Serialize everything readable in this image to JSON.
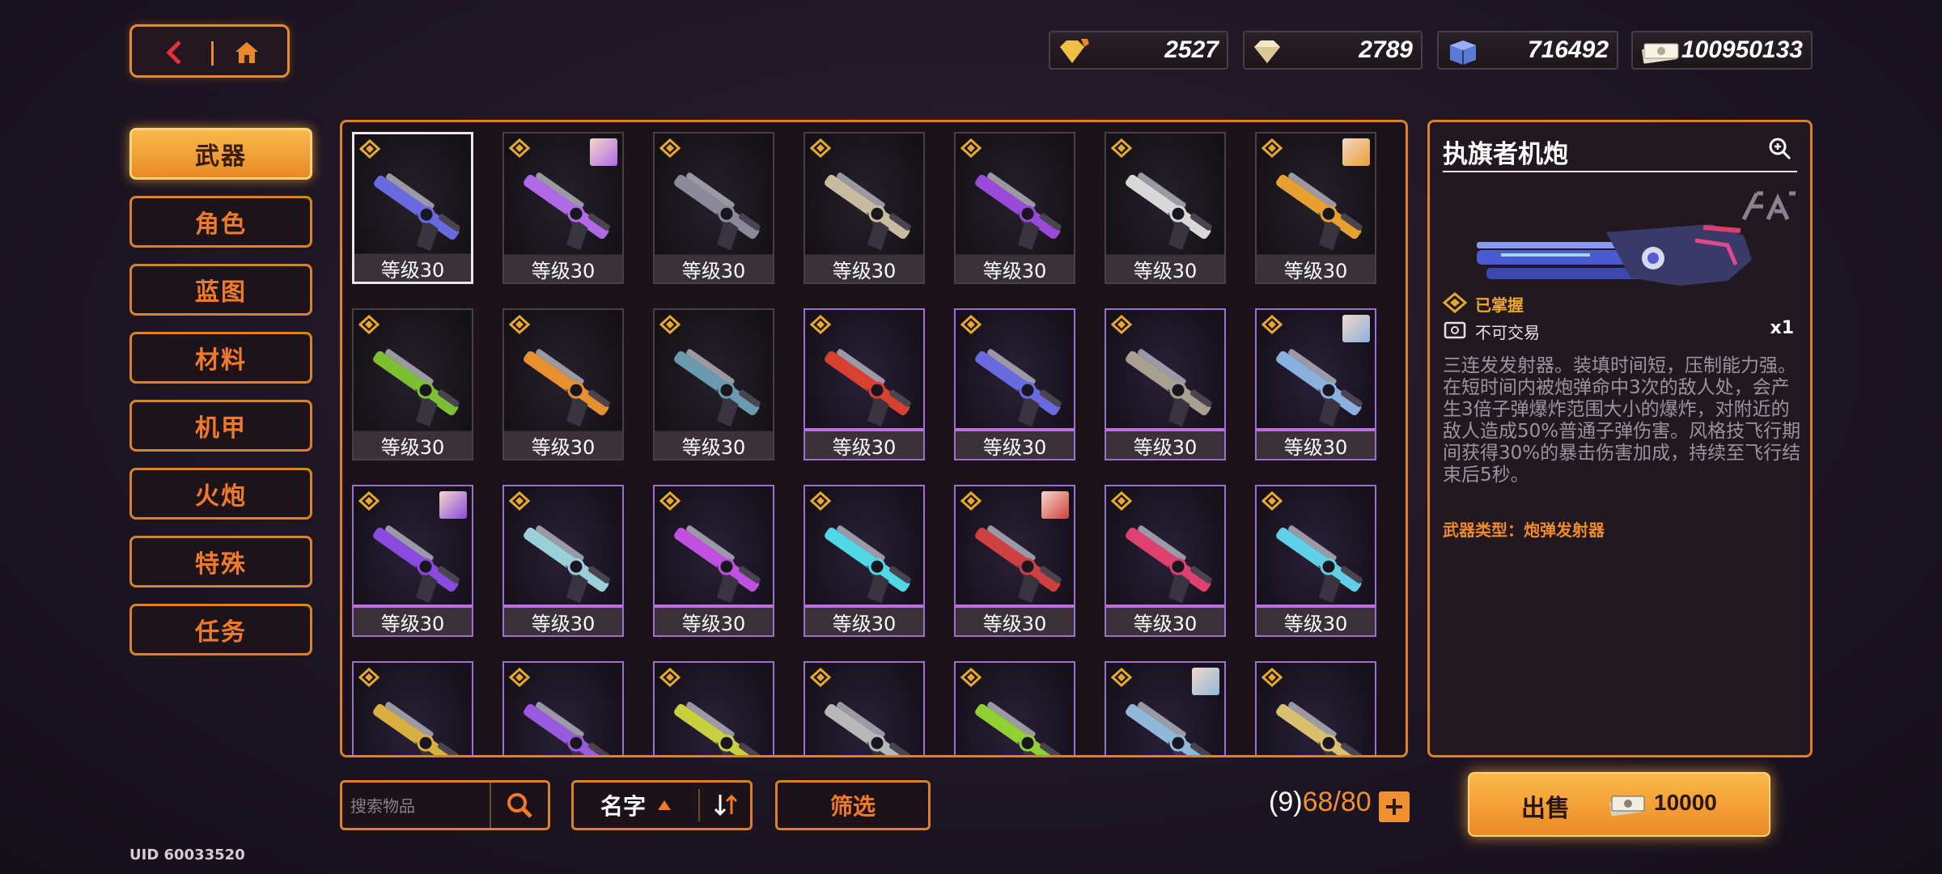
{
  "nav": {
    "back_icon": "chevron-left-icon",
    "home_icon": "home-icon"
  },
  "currencies": [
    {
      "icon": "gold-diamond-gem-icon",
      "value": "2527"
    },
    {
      "icon": "diamond-gem-icon",
      "value": "2789"
    },
    {
      "icon": "blue-crate-icon",
      "value": "716492"
    },
    {
      "icon": "cash-stack-icon",
      "value": "100950133"
    }
  ],
  "sidebar": {
    "items": [
      {
        "label": "武器",
        "active": true
      },
      {
        "label": "角色",
        "active": false
      },
      {
        "label": "蓝图",
        "active": false
      },
      {
        "label": "材料",
        "active": false
      },
      {
        "label": "机甲",
        "active": false
      },
      {
        "label": "火炮",
        "active": false
      },
      {
        "label": "特殊",
        "active": false
      },
      {
        "label": "任务",
        "active": false
      }
    ]
  },
  "grid": {
    "items": [
      {
        "level": "等级30",
        "rarity": "grey",
        "selected": true,
        "color": "#6a6ae0",
        "avatar": false
      },
      {
        "level": "等级30",
        "rarity": "grey",
        "selected": false,
        "color": "#b06ae8",
        "avatar": true
      },
      {
        "level": "等级30",
        "rarity": "grey",
        "selected": false,
        "color": "#8a8a9a",
        "avatar": false
      },
      {
        "level": "等级30",
        "rarity": "grey",
        "selected": false,
        "color": "#c8bca0",
        "avatar": false
      },
      {
        "level": "等级30",
        "rarity": "grey",
        "selected": false,
        "color": "#9a4ad8",
        "avatar": false
      },
      {
        "level": "等级30",
        "rarity": "grey",
        "selected": false,
        "color": "#d8d8d8",
        "avatar": false
      },
      {
        "level": "等级30",
        "rarity": "grey",
        "selected": false,
        "color": "#e8a030",
        "avatar": true
      },
      {
        "level": "等级30",
        "rarity": "grey",
        "selected": false,
        "color": "#7ac030",
        "avatar": false
      },
      {
        "level": "等级30",
        "rarity": "grey",
        "selected": false,
        "color": "#e89030",
        "avatar": false
      },
      {
        "level": "等级30",
        "rarity": "grey",
        "selected": false,
        "color": "#6a9ab0",
        "avatar": false
      },
      {
        "level": "等级30",
        "rarity": "purple",
        "selected": false,
        "color": "#d84030",
        "avatar": false
      },
      {
        "level": "等级30",
        "rarity": "purple",
        "selected": false,
        "color": "#6a6ae0",
        "avatar": false
      },
      {
        "level": "等级30",
        "rarity": "purple",
        "selected": false,
        "color": "#a8a090",
        "avatar": false
      },
      {
        "level": "等级30",
        "rarity": "purple",
        "selected": false,
        "color": "#8ab0e0",
        "avatar": true
      },
      {
        "level": "等级30",
        "rarity": "purple",
        "selected": false,
        "color": "#8a4ae0",
        "avatar": true
      },
      {
        "level": "等级30",
        "rarity": "purple",
        "selected": false,
        "color": "#9ad0d8",
        "avatar": false
      },
      {
        "level": "等级30",
        "rarity": "purple",
        "selected": false,
        "color": "#c050e0",
        "avatar": false
      },
      {
        "level": "等级30",
        "rarity": "purple",
        "selected": false,
        "color": "#50d8e8",
        "avatar": false
      },
      {
        "level": "等级30",
        "rarity": "purple",
        "selected": false,
        "color": "#d04040",
        "avatar": true
      },
      {
        "level": "等级30",
        "rarity": "purple",
        "selected": false,
        "color": "#e04070",
        "avatar": false
      },
      {
        "level": "等级30",
        "rarity": "purple",
        "selected": false,
        "color": "#60d0e8",
        "avatar": false
      },
      {
        "level": "",
        "rarity": "purple",
        "selected": false,
        "color": "#d8b040",
        "avatar": false
      },
      {
        "level": "",
        "rarity": "purple",
        "selected": false,
        "color": "#9a5ae0",
        "avatar": false
      },
      {
        "level": "",
        "rarity": "purple",
        "selected": false,
        "color": "#c8d040",
        "avatar": false
      },
      {
        "level": "",
        "rarity": "purple",
        "selected": false,
        "color": "#b8b8b8",
        "avatar": false
      },
      {
        "level": "",
        "rarity": "purple",
        "selected": false,
        "color": "#90d030",
        "avatar": false
      },
      {
        "level": "",
        "rarity": "purple",
        "selected": false,
        "color": "#90b8d8",
        "avatar": true
      },
      {
        "level": "",
        "rarity": "purple",
        "selected": false,
        "color": "#d8c070",
        "avatar": false
      }
    ]
  },
  "detail": {
    "title": "执旗者机炮",
    "zoom_icon": "zoom-in-icon",
    "mastered": "已掌握",
    "untradable": "不可交易",
    "quantity": "x1",
    "description": "三连发发射器。装填时间短，压制能力强。在短时间内被炮弹命中3次的敌人处，会产生3倍子弹爆炸范围大小的爆炸，对附近的敌人造成50%普通子弹伤害。风格技飞行期间获得30%的暴击伤害加成，持续至飞行结束后5秒。",
    "weapon_type": "武器类型：炮弹发射器"
  },
  "bottom": {
    "search_placeholder": "搜索物品",
    "sort_label": "名字",
    "filter_label": "筛选",
    "capacity_prefix": "(9)",
    "capacity_count": "68/80",
    "sell_label": "出售",
    "sell_price": "10000",
    "uid": "UID 60033520"
  },
  "colors": {
    "accent": "#e8892e",
    "active": "#f9b94d",
    "rarity_purple": "#9c6fd0"
  }
}
